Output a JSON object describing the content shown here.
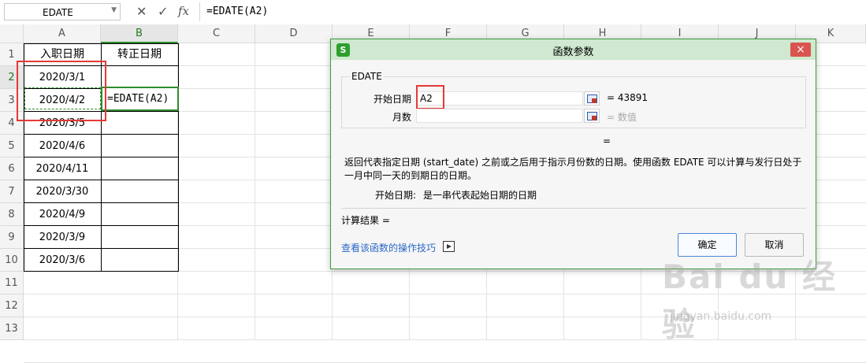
{
  "formula_bar": {
    "name_box": "EDATE",
    "cancel_icon": "✕",
    "confirm_icon": "✓",
    "fx_label": "fx",
    "formula": "=EDATE(A2)"
  },
  "columns": [
    "A",
    "B",
    "C",
    "D",
    "E",
    "F",
    "G",
    "H",
    "I",
    "J",
    "K"
  ],
  "rows": [
    "1",
    "2",
    "3",
    "4",
    "5",
    "6",
    "7",
    "8",
    "9",
    "10",
    "11",
    "12",
    "13"
  ],
  "table": {
    "headers": [
      "入职日期",
      "转正日期"
    ],
    "a_values": [
      "2020/3/1",
      "2020/4/2",
      "2020/3/5",
      "2020/4/6",
      "2020/4/11",
      "2020/3/30",
      "2020/4/9",
      "2020/3/9",
      "2020/3/6"
    ],
    "edit_cell": "=EDATE(A2)"
  },
  "dialog": {
    "title": "函数参数",
    "logo": "S",
    "close": "×",
    "function_name": "EDATE",
    "params": [
      {
        "label": "开始日期",
        "value": "A2",
        "result": "=  43891"
      },
      {
        "label": "月数",
        "value": "",
        "result": "=  数值"
      }
    ],
    "result_eq": "=",
    "description": "返回代表指定日期 (start_date) 之前或之后用于指示月份数的日期。使用函数 EDATE 可以计算与发行日处于一月中同一天的到期日的日期。",
    "param_help_label": "开始日期:",
    "param_help_text": "是一串代表起始日期的日期",
    "calc_result": "计算结果  =",
    "help_link": "查看该函数的操作技巧",
    "ok": "确定",
    "cancel": "取消"
  },
  "watermark": {
    "main": "Bai du 经验",
    "url": "jingyan.baidu.com"
  },
  "colors": {
    "accent_green": "#2e8b2e",
    "highlight_red": "#e53935",
    "dialog_title": "#cfe8cf",
    "link_blue": "#2b68c8"
  }
}
